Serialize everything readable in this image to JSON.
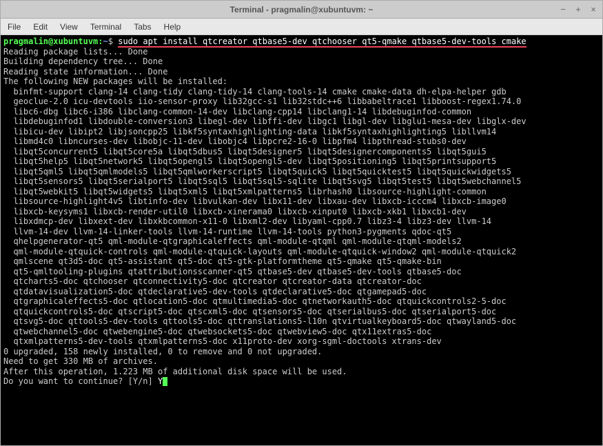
{
  "window": {
    "title": "Terminal - pragmalin@xubuntuvm: ~",
    "controls": {
      "minimize": "−",
      "maximize": "+",
      "close": "×"
    }
  },
  "menubar": {
    "items": [
      "File",
      "Edit",
      "View",
      "Terminal",
      "Tabs",
      "Help"
    ]
  },
  "prompt": {
    "user_host": "pragmalin@xubuntuvm",
    "separator": ":",
    "path": "~",
    "symbol": "$"
  },
  "command": "sudo apt install qtcreator qtbase5-dev qtchooser qt5-qmake qtbase5-dev-tools cmake",
  "output_lines": [
    "Reading package lists... Done",
    "Building dependency tree... Done",
    "Reading state information... Done",
    "The following NEW packages will be installed:",
    "  binfmt-support clang-14 clang-tidy clang-tidy-14 clang-tools-14 cmake cmake-data dh-elpa-helper gdb",
    "  geoclue-2.0 icu-devtools iio-sensor-proxy lib32gcc-s1 lib32stdc++6 libbabeltrace1 libboost-regex1.74.0",
    "  libc6-dbg libc6-i386 libclang-common-14-dev libclang-cpp14 libclang1-14 libdebuginfod-common",
    "  libdebuginfod1 libdouble-conversion3 libegl-dev libffi-dev libgc1 libgl-dev libglu1-mesa-dev libglx-dev",
    "  libicu-dev libipt2 libjsoncpp25 libkf5syntaxhighlighting-data libkf5syntaxhighlighting5 libllvm14",
    "  libmd4c0 libncurses-dev libobjc-11-dev libobjc4 libpcre2-16-0 libpfm4 libpthread-stubs0-dev",
    "  libqt5concurrent5 libqt5core5a libqt5dbus5 libqt5designer5 libqt5designercomponents5 libqt5gui5",
    "  libqt5help5 libqt5network5 libqt5opengl5 libqt5opengl5-dev libqt5positioning5 libqt5printsupport5",
    "  libqt5qml5 libqt5qmlmodels5 libqt5qmlworkerscript5 libqt5quick5 libqt5quicktest5 libqt5quickwidgets5",
    "  libqt5sensors5 libqt5serialport5 libqt5sql5 libqt5sql5-sqlite libqt5svg5 libqt5test5 libqt5webchannel5",
    "  libqt5webkit5 libqt5widgets5 libqt5xml5 libqt5xmlpatterns5 librhash0 libsource-highlight-common",
    "  libsource-highlight4v5 libtinfo-dev libvulkan-dev libx11-dev libxau-dev libxcb-icccm4 libxcb-image0",
    "  libxcb-keysyms1 libxcb-render-util0 libxcb-xinerama0 libxcb-xinput0 libxcb-xkb1 libxcb1-dev",
    "  libxdmcp-dev libxext-dev libxkbcommon-x11-0 libxml2-dev libyaml-cpp0.7 libz3-4 libz3-dev llvm-14",
    "  llvm-14-dev llvm-14-linker-tools llvm-14-runtime llvm-14-tools python3-pygments qdoc-qt5",
    "  qhelpgenerator-qt5 qml-module-qtgraphicaleffects qml-module-qtqml qml-module-qtqml-models2",
    "  qml-module-qtquick-controls qml-module-qtquick-layouts qml-module-qtquick-window2 qml-module-qtquick2",
    "  qmlscene qt3d5-doc qt5-assistant qt5-doc qt5-gtk-platformtheme qt5-qmake qt5-qmake-bin",
    "  qt5-qmltooling-plugins qtattributionsscanner-qt5 qtbase5-dev qtbase5-dev-tools qtbase5-doc",
    "  qtcharts5-doc qtchooser qtconnectivity5-doc qtcreator qtcreator-data qtcreator-doc",
    "  qtdatavisualization5-doc qtdeclarative5-dev-tools qtdeclarative5-doc qtgamepad5-doc",
    "  qtgraphicaleffects5-doc qtlocation5-doc qtmultimedia5-doc qtnetworkauth5-doc qtquickcontrols2-5-doc",
    "  qtquickcontrols5-doc qtscript5-doc qtscxml5-doc qtsensors5-doc qtserialbus5-doc qtserialport5-doc",
    "  qtsvg5-doc qttools5-dev-tools qttools5-doc qttranslations5-l10n qtvirtualkeyboard5-doc qtwayland5-doc",
    "  qtwebchannel5-doc qtwebengine5-doc qtwebsockets5-doc qtwebview5-doc qtx11extras5-doc",
    "  qtxmlpatterns5-dev-tools qtxmlpatterns5-doc x11proto-dev xorg-sgml-doctools xtrans-dev",
    "0 upgraded, 158 newly installed, 0 to remove and 0 not upgraded.",
    "Need to get 330 MB of archives.",
    "After this operation, 1.223 MB of additional disk space will be used."
  ],
  "continue_prompt": "Do you want to continue? [Y/n] ",
  "continue_answer": "Y"
}
